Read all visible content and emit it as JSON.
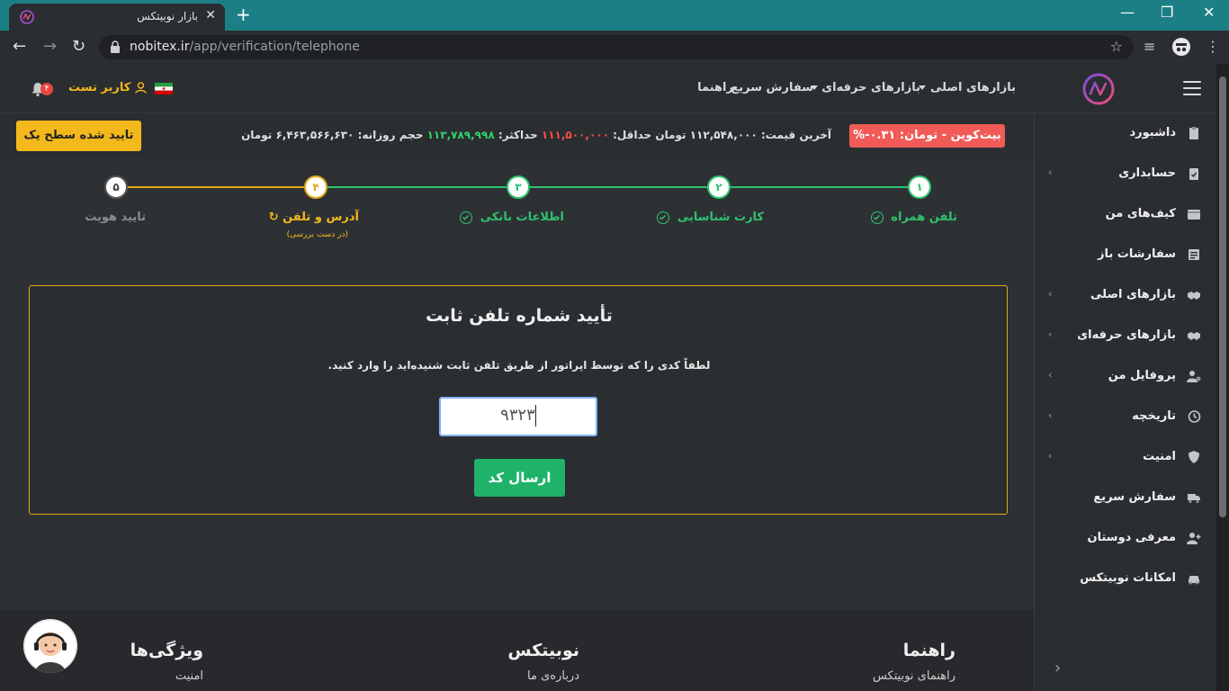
{
  "browser": {
    "tab_title": "بازار نوبیتکس",
    "url_domain": "nobitex.ir",
    "url_path": "/app/verification/telephone"
  },
  "header": {
    "nav": {
      "main_markets": "بازارهای اصلی",
      "pro_markets": "بازارهای حرفه‌ای",
      "quick_order": "سفارش سریع",
      "guide": "راهنما"
    },
    "user_name": "کاربر تست",
    "notification_count": "۴"
  },
  "ticker": {
    "verified_label": "تایید شده سطح یک",
    "btc_badge": "بیت‌کوین - تومان: ۰.۳۱-%",
    "last_price_label": "آخرین قیمت:",
    "last_price": "۱۱۲,۵۴۸,۰۰۰ تومان",
    "min_label": "حداقل:",
    "min_value": "۱۱۱,۵۰۰,۰۰۰",
    "max_label": "حداکثر:",
    "max_value": "۱۱۳,۷۸۹,۹۹۸",
    "volume_label": "حجم روزانه:",
    "volume_value": "۶,۴۶۳,۵۶۶,۶۳۰ تومان"
  },
  "stepper": {
    "steps": [
      {
        "num": "۱",
        "label": "تلفن همراه",
        "state": "done"
      },
      {
        "num": "۲",
        "label": "کارت شناسایی",
        "state": "done"
      },
      {
        "num": "۳",
        "label": "اطلاعات بانکی",
        "state": "done"
      },
      {
        "num": "۴",
        "label": "آدرس و تلفن",
        "sub": "(در دست بررسی)",
        "state": "active"
      },
      {
        "num": "۵",
        "label": "تایید هویت",
        "state": "pending"
      }
    ]
  },
  "card": {
    "title": "تأیید شماره تلفن ثابت",
    "description": "لطفاً کدی را که توسط اپراتور از طریق تلفن ثابت شنیده‌اید را وارد کنید.",
    "code_value": "۹۳۲۳",
    "submit_label": "ارسال کد"
  },
  "footer": {
    "col1_title": "راهنما",
    "col1_link": "راهنمای نوبیتکس",
    "col2_title": "نوبیتکس",
    "col2_link": "درباره‌ی ما",
    "col3_title": "ویژگی‌ها",
    "col3_link": "امنیت"
  },
  "sidebar": {
    "items": [
      {
        "label": "داشبورد",
        "icon": "clipboard-icon",
        "chevron": false
      },
      {
        "label": "حسابداری",
        "icon": "clipboard-check-icon",
        "chevron": true
      },
      {
        "label": "کیف‌های من",
        "icon": "wallet-icon",
        "chevron": false
      },
      {
        "label": "سفارشات باز",
        "icon": "list-icon",
        "chevron": false
      },
      {
        "label": "بازارهای اصلی",
        "icon": "handshake-icon",
        "chevron": true
      },
      {
        "label": "بازارهای حرفه‌ای",
        "icon": "handshake-icon",
        "chevron": true
      },
      {
        "label": "پروفایل من",
        "icon": "user-gear-icon",
        "chevron": true
      },
      {
        "label": "تاریخچه",
        "icon": "history-icon",
        "chevron": true
      },
      {
        "label": "امنیت",
        "icon": "shield-icon",
        "chevron": true
      },
      {
        "label": "سفارش سریع",
        "icon": "truck-icon",
        "chevron": false
      },
      {
        "label": "معرفی دوستان",
        "icon": "user-plus-icon",
        "chevron": false
      },
      {
        "label": "امکانات نوبیتکس",
        "icon": "car-icon",
        "chevron": false
      }
    ]
  },
  "colors": {
    "accent_yellow": "#f3b81b",
    "success_green": "#1fb36a",
    "danger_red": "#f05b57"
  }
}
